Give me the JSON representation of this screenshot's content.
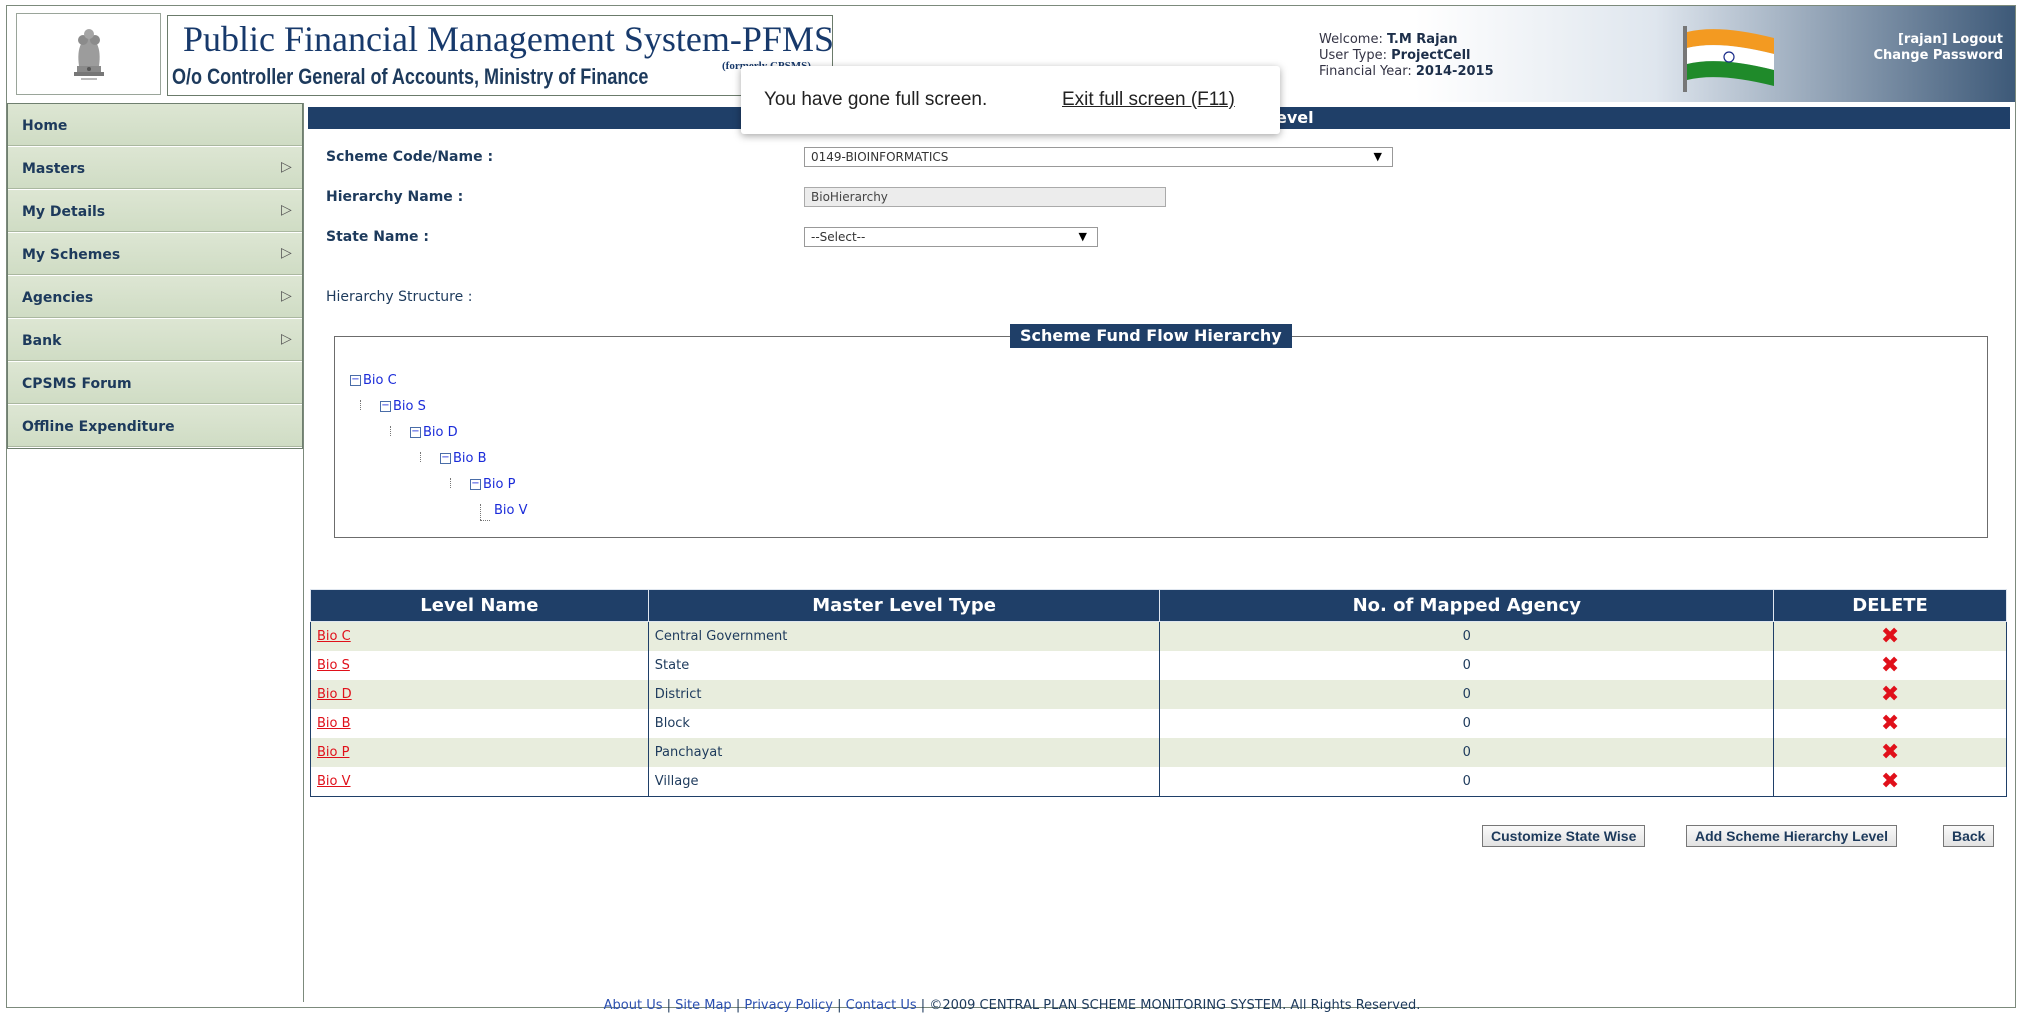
{
  "header": {
    "title": "Public Financial Management System-PFMS",
    "formerly": "(formerly CPSMS)",
    "subtitle": "O/o Controller General of Accounts, Ministry of Finance",
    "welcome_label": "Welcome:",
    "welcome_user": "T.M Rajan",
    "user_type_label": "User Type:",
    "user_type": "ProjectCell",
    "fy_label": "Financial Year:",
    "fy": "2014-2015",
    "login_user": "[rajan]",
    "logout": "Logout",
    "change_password": "Change Password"
  },
  "sidebar": {
    "items": [
      {
        "label": "Home",
        "has_submenu": false
      },
      {
        "label": "Masters",
        "has_submenu": true
      },
      {
        "label": "My Details",
        "has_submenu": true
      },
      {
        "label": "My Schemes",
        "has_submenu": true
      },
      {
        "label": "Agencies",
        "has_submenu": true
      },
      {
        "label": "Bank",
        "has_submenu": true
      },
      {
        "label": "CPSMS Forum",
        "has_submenu": false
      },
      {
        "label": "Offline Expenditure",
        "has_submenu": false
      }
    ],
    "arrow_glyph": "▷"
  },
  "main": {
    "section_title": "evel",
    "scheme_label": "Scheme Code/Name :",
    "scheme_value": "0149-BIOINFORMATICS",
    "hierarchy_label": "Hierarchy Name :",
    "hierarchy_value": "BioHierarchy",
    "state_label": "State Name :",
    "state_value": "--Select--",
    "structure_label": "Hierarchy Structure :",
    "tree_title": "Scheme Fund Flow Hierarchy",
    "tree": [
      "Bio C",
      "Bio S",
      "Bio D",
      "Bio B",
      "Bio P",
      "Bio V"
    ]
  },
  "table": {
    "headers": [
      "Level Name",
      "Master Level Type",
      "No. of Mapped Agency",
      "DELETE"
    ],
    "rows": [
      {
        "level": "Bio C",
        "type": "Central Government",
        "count": "0"
      },
      {
        "level": "Bio S",
        "type": "State",
        "count": "0"
      },
      {
        "level": "Bio D",
        "type": "District",
        "count": "0"
      },
      {
        "level": "Bio B",
        "type": "Block",
        "count": "0"
      },
      {
        "level": "Bio P",
        "type": "Panchayat",
        "count": "0"
      },
      {
        "level": "Bio V",
        "type": "Village",
        "count": "0"
      }
    ],
    "delete_glyph": "✖"
  },
  "buttons": {
    "customize": "Customize State Wise",
    "add": "Add Scheme Hierarchy Level",
    "back": "Back"
  },
  "footer": {
    "about": "About Us",
    "sitemap": "Site Map",
    "privacy": "Privacy Policy",
    "contact": "Contact Us",
    "sep": "|",
    "copyright": "©2009 CENTRAL PLAN SCHEME MONITORING SYSTEM. All Rights Reserved."
  },
  "toast": {
    "message": "You have gone full screen.",
    "exit": "Exit full screen (F11)"
  },
  "colors": {
    "navy": "#1f3f68",
    "menu_bg": "#cfdcc4",
    "row_alt": "#e8eddd",
    "link_red": "#e0101a",
    "tree_blue": "#1a2bd9"
  }
}
